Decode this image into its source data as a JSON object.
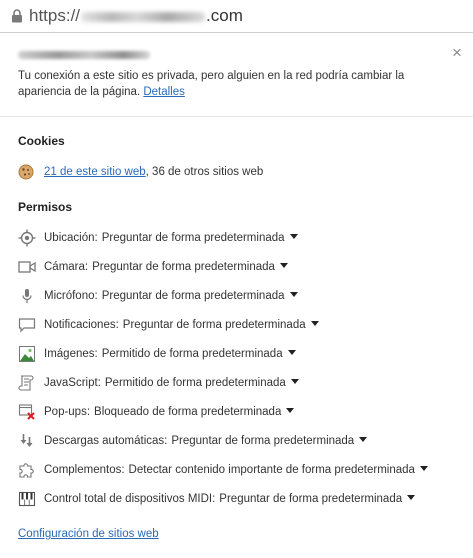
{
  "omnibox": {
    "scheme": "https://",
    "domain_suffix": ".com"
  },
  "bubble": {
    "connection_text": "Tu conexión a este sitio es privada, pero alguien en la red podría cambiar la apariencia de la página.",
    "details_link": "Detalles",
    "close_label": "×",
    "cookies": {
      "title": "Cookies",
      "link_text": "21 de este sitio web",
      "rest_text": ", 36 de otros sitios web"
    },
    "permissions": {
      "title": "Permisos",
      "items": [
        {
          "label": "Ubicación:",
          "value": "Preguntar de forma predeterminada"
        },
        {
          "label": "Cámara:",
          "value": "Preguntar de forma predeterminada"
        },
        {
          "label": "Micrófono:",
          "value": "Preguntar de forma predeterminada"
        },
        {
          "label": "Notificaciones:",
          "value": "Preguntar de forma predeterminada"
        },
        {
          "label": "Imágenes:",
          "value": "Permitido de forma predeterminada"
        },
        {
          "label": "JavaScript:",
          "value": "Permitido de forma predeterminada"
        },
        {
          "label": "Pop-ups:",
          "value": "Bloqueado de forma predeterminada"
        },
        {
          "label": "Descargas automáticas:",
          "value": "Preguntar de forma predeterminada"
        },
        {
          "label": "Complementos:",
          "value": "Detectar contenido importante de forma predeterminada"
        },
        {
          "label": "Control total de dispositivos MIDI:",
          "value": "Preguntar de forma predeterminada"
        }
      ]
    },
    "footer_link": "Configuración de sitios web"
  }
}
